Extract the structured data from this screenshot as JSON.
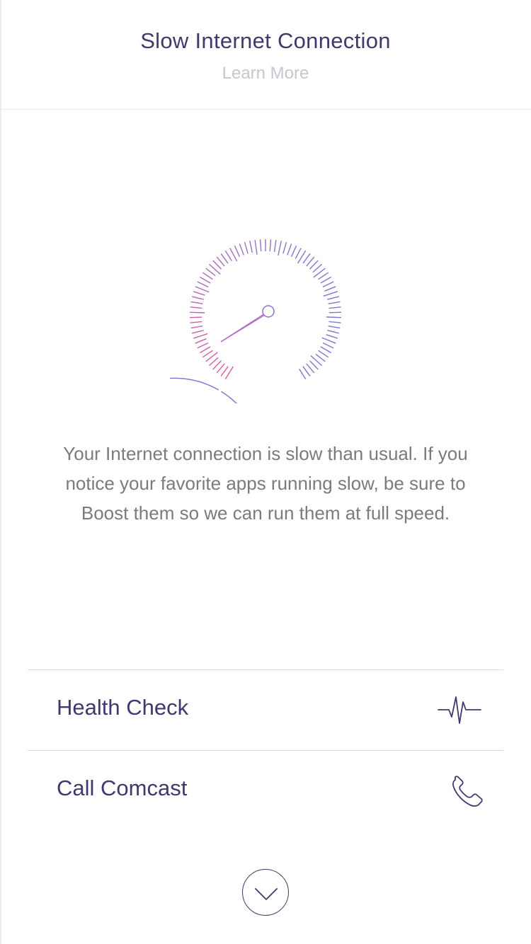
{
  "header": {
    "title": "Slow Internet Connection",
    "learn_more": "Learn More"
  },
  "gauge": {
    "icon": "speedometer-icon",
    "level_description": "low"
  },
  "message": "Your Internet connection is slow than usual. If you notice your favorite apps running slow, be sure to Boost them so we can run them at full speed.",
  "actions": [
    {
      "label": "Health Check",
      "icon": "pulse-icon"
    },
    {
      "label": "Call Comcast",
      "icon": "phone-icon"
    }
  ],
  "expand": {
    "icon": "chevron-down-icon"
  },
  "colors": {
    "primary": "#3f3a6e",
    "muted_text": "#7a7a80",
    "light_text": "#c6c6cc",
    "gauge_start": "#e05aa0",
    "gauge_end": "#7b78d6"
  }
}
